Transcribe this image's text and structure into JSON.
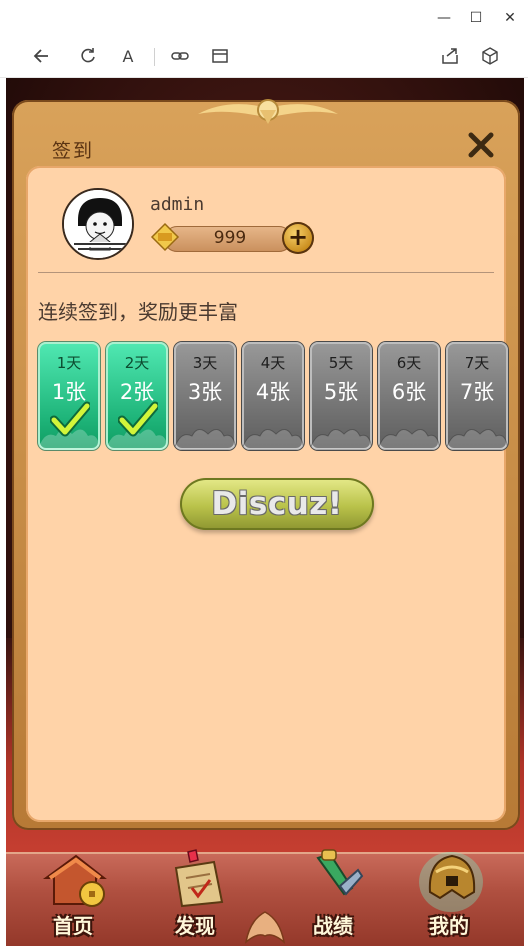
{
  "window": {
    "minimize_glyph": "—",
    "maximize_glyph": "☐",
    "close_glyph": "✕"
  },
  "toolbar": {
    "icons": [
      "back-icon",
      "refresh-icon",
      "font-icon",
      "link-icon",
      "window-icon",
      "share-icon",
      "cube-icon"
    ],
    "font_glyph": "A"
  },
  "dialog": {
    "title": "签到",
    "close_icon": "close-icon"
  },
  "user": {
    "name": "admin",
    "coins": "999",
    "plus": "+"
  },
  "checkin": {
    "subtitle": "连续签到，奖励更丰富",
    "days": [
      {
        "label": "1天",
        "reward": "1张",
        "done": true
      },
      {
        "label": "2天",
        "reward": "2张",
        "done": true
      },
      {
        "label": "3天",
        "reward": "3张",
        "done": false
      },
      {
        "label": "4天",
        "reward": "4张",
        "done": false
      },
      {
        "label": "5天",
        "reward": "5张",
        "done": false
      },
      {
        "label": "6天",
        "reward": "6张",
        "done": false
      },
      {
        "label": "7天",
        "reward": "7张",
        "done": false
      }
    ]
  },
  "brand_button": {
    "label": "Discuz!"
  },
  "nav": {
    "items": [
      {
        "label": "首页",
        "icon": "home-icon"
      },
      {
        "label": "发现",
        "icon": "discover-icon"
      },
      {
        "label": "战绩",
        "icon": "sword-icon"
      },
      {
        "label": "我的",
        "icon": "helmet-icon"
      }
    ]
  },
  "colors": {
    "dialog_bg": "#ffd3a8",
    "day_done": "#1fb57a",
    "day_todo": "#6e6e6e",
    "nav_bg": "#b05040"
  }
}
